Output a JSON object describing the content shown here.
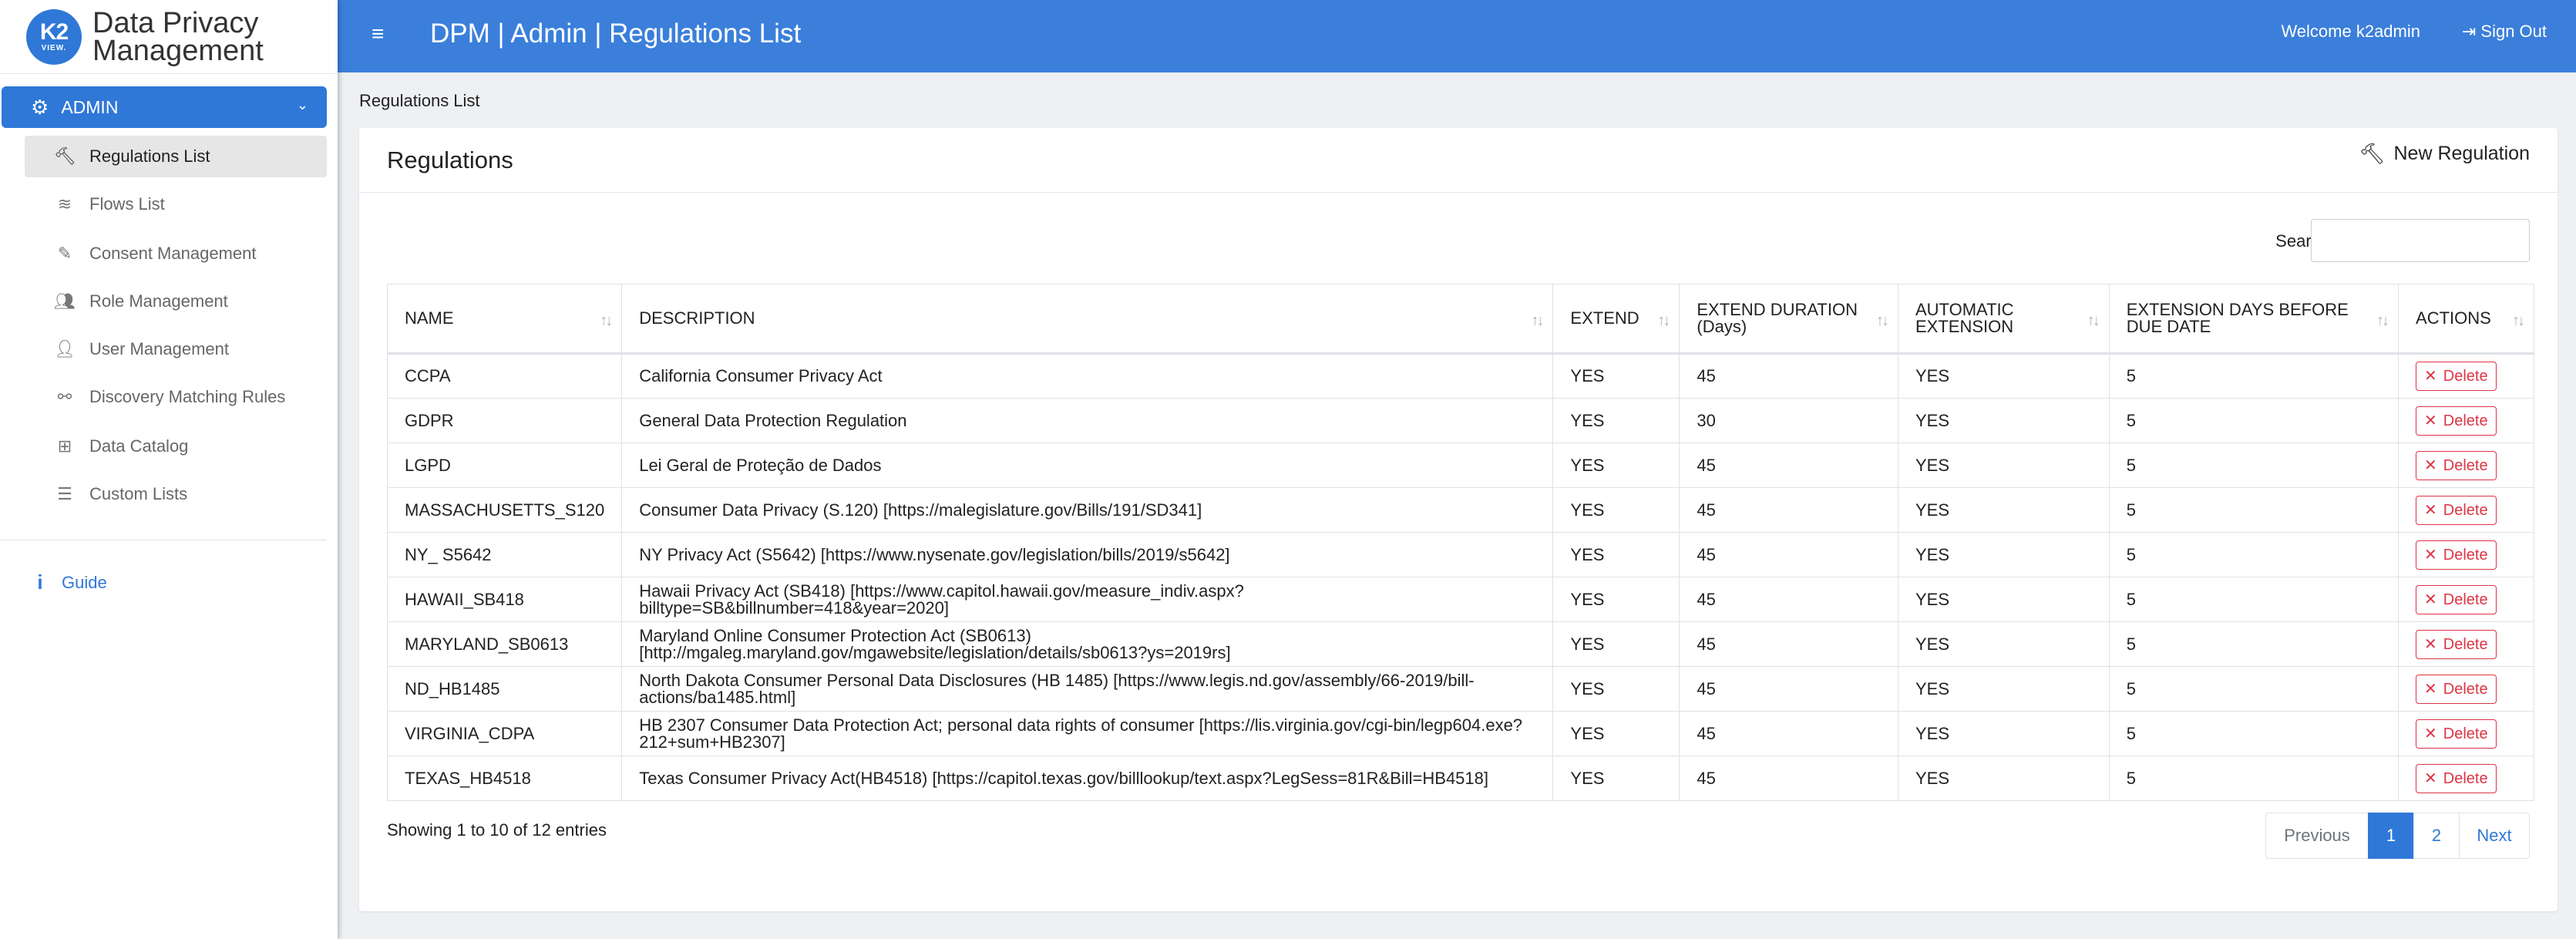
{
  "brand": {
    "logo_top": "K2",
    "logo_bottom": "VIEW.",
    "line1": "Data Privacy",
    "line2": "Management"
  },
  "header": {
    "title": "DPM | Admin | Regulations List",
    "welcome": "Welcome k2admin",
    "signout": "Sign Out"
  },
  "sidebar": {
    "section": "ADMIN",
    "items": [
      {
        "label": "Regulations List",
        "icon": "gavel-icon"
      },
      {
        "label": "Flows List",
        "icon": "flows-icon"
      },
      {
        "label": "Consent Management",
        "icon": "edit-document-icon"
      },
      {
        "label": "Role Management",
        "icon": "users-icon"
      },
      {
        "label": "User Management",
        "icon": "user-icon"
      },
      {
        "label": "Discovery Matching Rules",
        "icon": "binoculars-icon"
      },
      {
        "label": "Data Catalog",
        "icon": "sitemap-icon"
      },
      {
        "label": "Custom Lists",
        "icon": "list-icon"
      }
    ],
    "guide": "Guide"
  },
  "breadcrumb": "Regulations List",
  "card": {
    "title": "Regulations",
    "new_button": "New Regulation",
    "search_label": "Search:",
    "search_value": ""
  },
  "table": {
    "columns": [
      "NAME",
      "DESCRIPTION",
      "EXTEND",
      "EXTEND DURATION (Days)",
      "AUTOMATIC EXTENSION",
      "EXTENSION DAYS BEFORE DUE DATE",
      "ACTIONS"
    ],
    "delete_label": "Delete",
    "rows": [
      [
        "CCPA",
        "California Consumer Privacy Act",
        "YES",
        "45",
        "YES",
        "5"
      ],
      [
        "GDPR",
        "General Data Protection Regulation",
        "YES",
        "30",
        "YES",
        "5"
      ],
      [
        "LGPD",
        "Lei Geral de Proteção de Dados",
        "YES",
        "45",
        "YES",
        "5"
      ],
      [
        "MASSACHUSETTS_S120",
        "Consumer Data Privacy (S.120) [https://malegislature.gov/Bills/191/SD341]",
        "YES",
        "45",
        "YES",
        "5"
      ],
      [
        "NY_ S5642",
        "NY Privacy Act (S5642) [https://www.nysenate.gov/legislation/bills/2019/s5642]",
        "YES",
        "45",
        "YES",
        "5"
      ],
      [
        "HAWAII_SB418",
        "Hawaii Privacy Act (SB418) [https://www.capitol.hawaii.gov/measure_indiv.aspx?billtype=SB&billnumber=418&year=2020]",
        "YES",
        "45",
        "YES",
        "5"
      ],
      [
        "MARYLAND_SB0613",
        "Maryland Online Consumer Protection Act (SB0613) [http://mgaleg.maryland.gov/mgawebsite/legislation/details/sb0613?ys=2019rs]",
        "YES",
        "45",
        "YES",
        "5"
      ],
      [
        "ND_HB1485",
        "North Dakota Consumer Personal Data Disclosures (HB 1485) [https://www.legis.nd.gov/assembly/66-2019/bill-actions/ba1485.html]",
        "YES",
        "45",
        "YES",
        "5"
      ],
      [
        "VIRGINIA_CDPA",
        "HB 2307 Consumer Data Protection Act; personal data rights of consumer [https://lis.virginia.gov/cgi-bin/legp604.exe?212+sum+HB2307]",
        "YES",
        "45",
        "YES",
        "5"
      ],
      [
        "TEXAS_HB4518",
        "Texas Consumer Privacy Act(HB4518) [https://capitol.texas.gov/billlookup/text.aspx?LegSess=81R&Bill=HB4518]",
        "YES",
        "45",
        "YES",
        "5"
      ]
    ]
  },
  "footer": {
    "showing": "Showing 1 to 10 of 12 entries",
    "previous": "Previous",
    "pages": [
      "1",
      "2"
    ],
    "current_page": "1",
    "next": "Next"
  },
  "colors": {
    "primary": "#3b7fdb",
    "danger": "#dc3545"
  }
}
